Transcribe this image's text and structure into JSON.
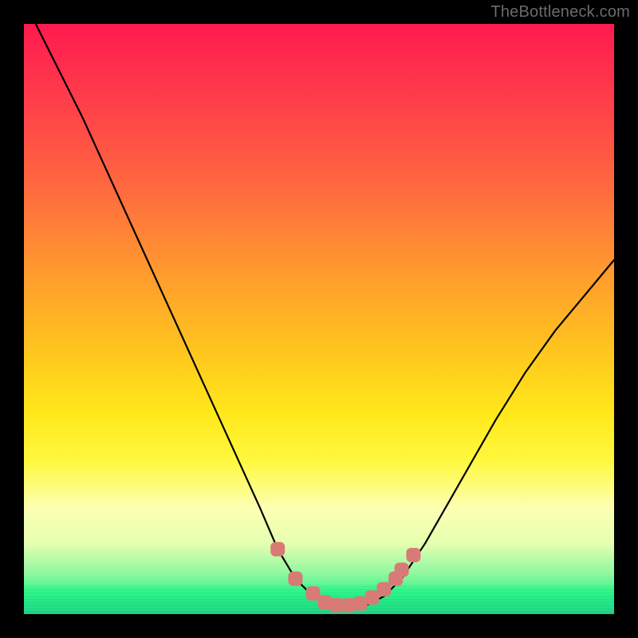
{
  "watermark": "TheBottleneck.com",
  "chart_data": {
    "type": "line",
    "title": "",
    "xlabel": "",
    "ylabel": "",
    "xlim": [
      0,
      100
    ],
    "ylim": [
      0,
      100
    ],
    "series": [
      {
        "name": "bottleneck-curve",
        "x": [
          0,
          5,
          10,
          15,
          20,
          25,
          30,
          35,
          40,
          43,
          46,
          49,
          52,
          55,
          58,
          61,
          64,
          68,
          72,
          76,
          80,
          85,
          90,
          95,
          100
        ],
        "values": [
          104,
          94,
          84,
          73,
          62,
          51,
          40,
          29,
          18,
          11,
          6,
          3,
          1.5,
          1.5,
          1.5,
          3,
          6,
          12,
          19,
          26,
          33,
          41,
          48,
          54,
          60
        ]
      }
    ],
    "markers": {
      "name": "highlight-points",
      "color": "#d87a76",
      "points": [
        {
          "x": 43,
          "y": 11
        },
        {
          "x": 46,
          "y": 6
        },
        {
          "x": 49,
          "y": 3.5
        },
        {
          "x": 51,
          "y": 2
        },
        {
          "x": 53,
          "y": 1.5
        },
        {
          "x": 55,
          "y": 1.5
        },
        {
          "x": 57,
          "y": 1.8
        },
        {
          "x": 59,
          "y": 2.8
        },
        {
          "x": 61,
          "y": 4.2
        },
        {
          "x": 63,
          "y": 6
        },
        {
          "x": 64,
          "y": 7.5
        },
        {
          "x": 66,
          "y": 10
        }
      ]
    },
    "background_gradient": {
      "top": "#ff1a4f",
      "mid": "#ffe81a",
      "bottom": "#1fe98a"
    }
  }
}
